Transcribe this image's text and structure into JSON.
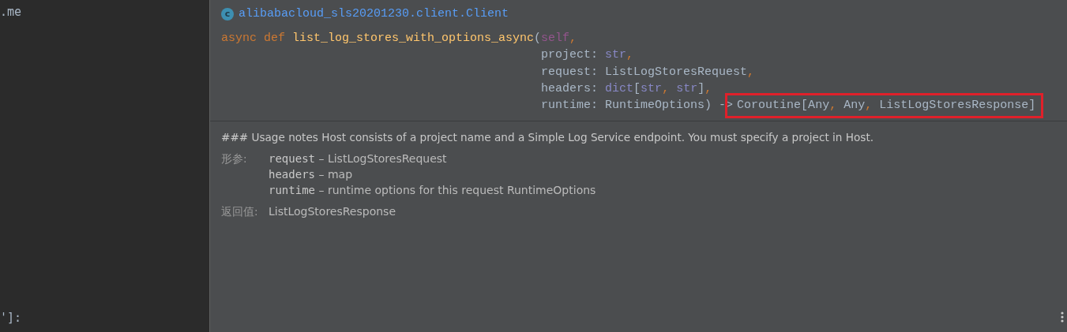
{
  "editor": {
    "lines": [
      ".me",
      "']:"
    ]
  },
  "popup": {
    "header": {
      "icon_letter": "c",
      "title": "alibabacloud_sls20201230.client.Client"
    },
    "signature": [
      {
        "tokens": [
          {
            "kind": "keyword",
            "text": "async def "
          },
          {
            "kind": "name",
            "text": "list_log_stores_with_options_async"
          },
          {
            "kind": "plain",
            "text": "("
          },
          {
            "kind": "self",
            "text": "self"
          },
          {
            "kind": "punct",
            "text": ","
          }
        ]
      },
      {
        "tokens": [
          {
            "kind": "plain",
            "text": "project: "
          },
          {
            "kind": "builtin",
            "text": "str"
          },
          {
            "kind": "punct",
            "text": ","
          }
        ]
      },
      {
        "tokens": [
          {
            "kind": "plain",
            "text": "request: ListLogStoresRequest"
          },
          {
            "kind": "punct",
            "text": ","
          }
        ]
      },
      {
        "tokens": [
          {
            "kind": "plain",
            "text": "headers: "
          },
          {
            "kind": "builtin",
            "text": "dict"
          },
          {
            "kind": "plain",
            "text": "["
          },
          {
            "kind": "builtin",
            "text": "str"
          },
          {
            "kind": "punct",
            "text": ", "
          },
          {
            "kind": "builtin",
            "text": "str"
          },
          {
            "kind": "plain",
            "text": "]"
          },
          {
            "kind": "punct",
            "text": ","
          }
        ]
      },
      {
        "tokens": [
          {
            "kind": "plain",
            "text": "runtime: RuntimeOptions) -> "
          },
          {
            "kind": "group",
            "boxed": true,
            "tokens": [
              {
                "kind": "plain",
                "text": "Coroutine[Any"
              },
              {
                "kind": "punct",
                "text": ", "
              },
              {
                "kind": "plain",
                "text": "Any"
              },
              {
                "kind": "punct",
                "text": ", "
              },
              {
                "kind": "plain",
                "text": "ListLogStoresResponse]"
              }
            ]
          }
        ]
      }
    ],
    "description": "### Usage notes Host consists of a project name and a Simple Log Service endpoint. You must specify a project in Host.",
    "params_label": "形参:",
    "params": [
      {
        "name": "request",
        "desc": "– ListLogStoresRequest"
      },
      {
        "name": "headers",
        "desc": "– map"
      },
      {
        "name": "runtime",
        "desc": "– runtime options for this request RuntimeOptions"
      }
    ],
    "returns_label": "返回值:",
    "returns": "ListLogStoresResponse"
  }
}
